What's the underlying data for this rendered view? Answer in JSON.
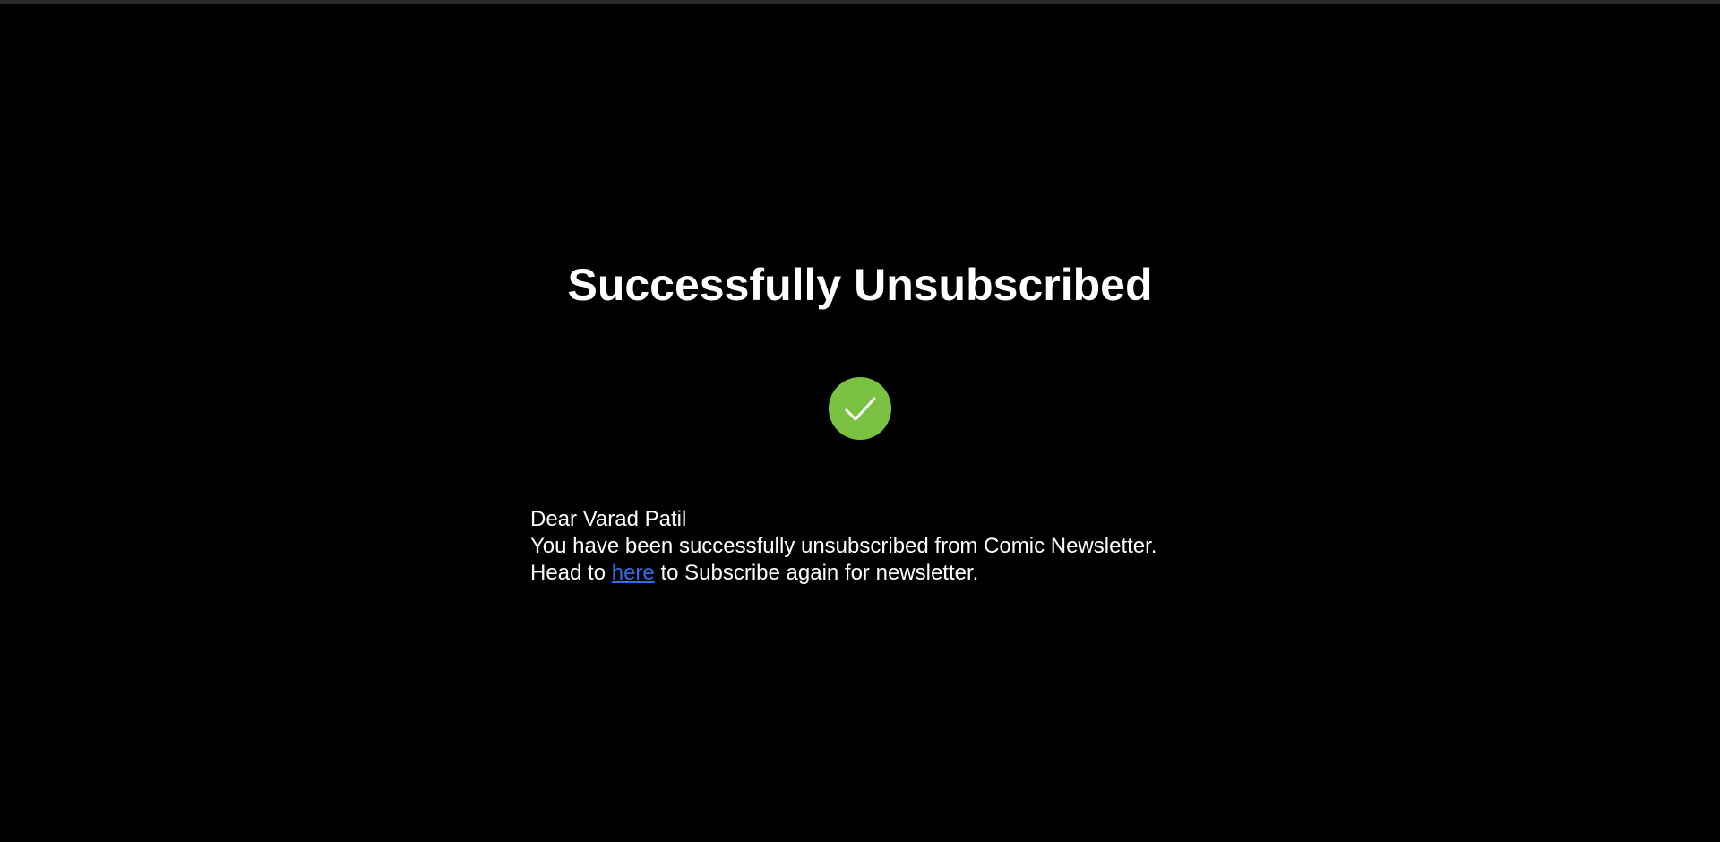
{
  "title": "Successfully Unsubscribed",
  "status_icon": "checkmark-circle-icon",
  "colors": {
    "background": "#000000",
    "success": "#7bc142",
    "link": "#2f6de1",
    "text": "#ffffff"
  },
  "message": {
    "greeting": "Dear Varad Patil",
    "body": "You have been successfully unsubscribed from Comic Newsletter.",
    "resubscribe_prefix": "Head to ",
    "resubscribe_link": "here",
    "resubscribe_suffix": " to Subscribe again for newsletter."
  }
}
